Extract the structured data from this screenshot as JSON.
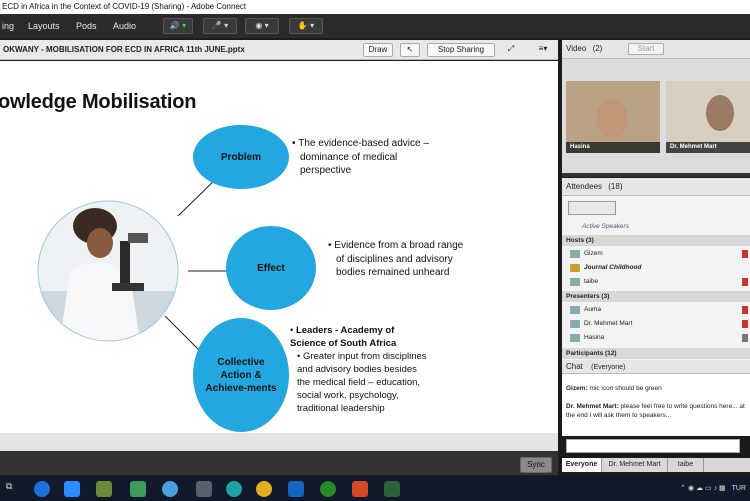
{
  "window": {
    "title": "ECD in Africa in the Context of COVID-19 (Sharing) - Adobe Connect"
  },
  "menu": {
    "items": [
      "ing",
      "Layouts",
      "Pods",
      "Audio"
    ]
  },
  "share_pod": {
    "title": "OKWANY  - MOBILISATION FOR ECD IN AFRICA  11th JUNE.pptx",
    "draw_label": "Draw",
    "stop_label": "Stop Sharing",
    "sync_label": "Sync"
  },
  "slide": {
    "title": "owledge Mobilisation",
    "circles": [
      {
        "label": "Problem"
      },
      {
        "label": "Effect"
      },
      {
        "label": "Collective Action & Achieve-ments"
      }
    ],
    "bullets": {
      "b1": "The evidence-based advice – dominance of medical perspective",
      "b2": "Evidence from a broad range of disciplines and advisory bodies remained unheard",
      "b3_head": "Leaders - Academy of Science of South Africa",
      "b3_body": "Greater input from disciplines and advisory bodies besides the medical field – education, social work, psychology, traditional leadership"
    }
  },
  "video": {
    "title": "Video",
    "count": "(2)",
    "start_label": "Start",
    "participants": [
      "Hasina",
      "Dr. Mehmet Mart"
    ]
  },
  "attendees": {
    "title": "Attendees",
    "count": "(18)",
    "active_speakers": "Active Speakers",
    "hosts_head": "Hosts (3)",
    "hosts": [
      "Gizem",
      "Journal Childhood",
      "taibe"
    ],
    "presenters_head": "Presenters (3)",
    "presenters": [
      "Auma",
      "Dr. Mehmet Mart",
      "Hasina"
    ],
    "participants_head": "Participants (12)"
  },
  "chat": {
    "title": "Chat",
    "scope": "(Everyone)",
    "messages": [
      {
        "sender": "Gizem:",
        "text": "mic icon should be green"
      },
      {
        "sender": "Dr. Mehmet Mart:",
        "text": "please feel free to write questions here... at the end I will ask them to speakers..."
      }
    ],
    "tabs": [
      "Everyone",
      "Dr. Mehmet Mart",
      "taibe"
    ]
  },
  "taskbar": {
    "lang": "TUR"
  },
  "colors": {
    "accent": "#22a7e0",
    "dark": "#2b2b2b"
  }
}
